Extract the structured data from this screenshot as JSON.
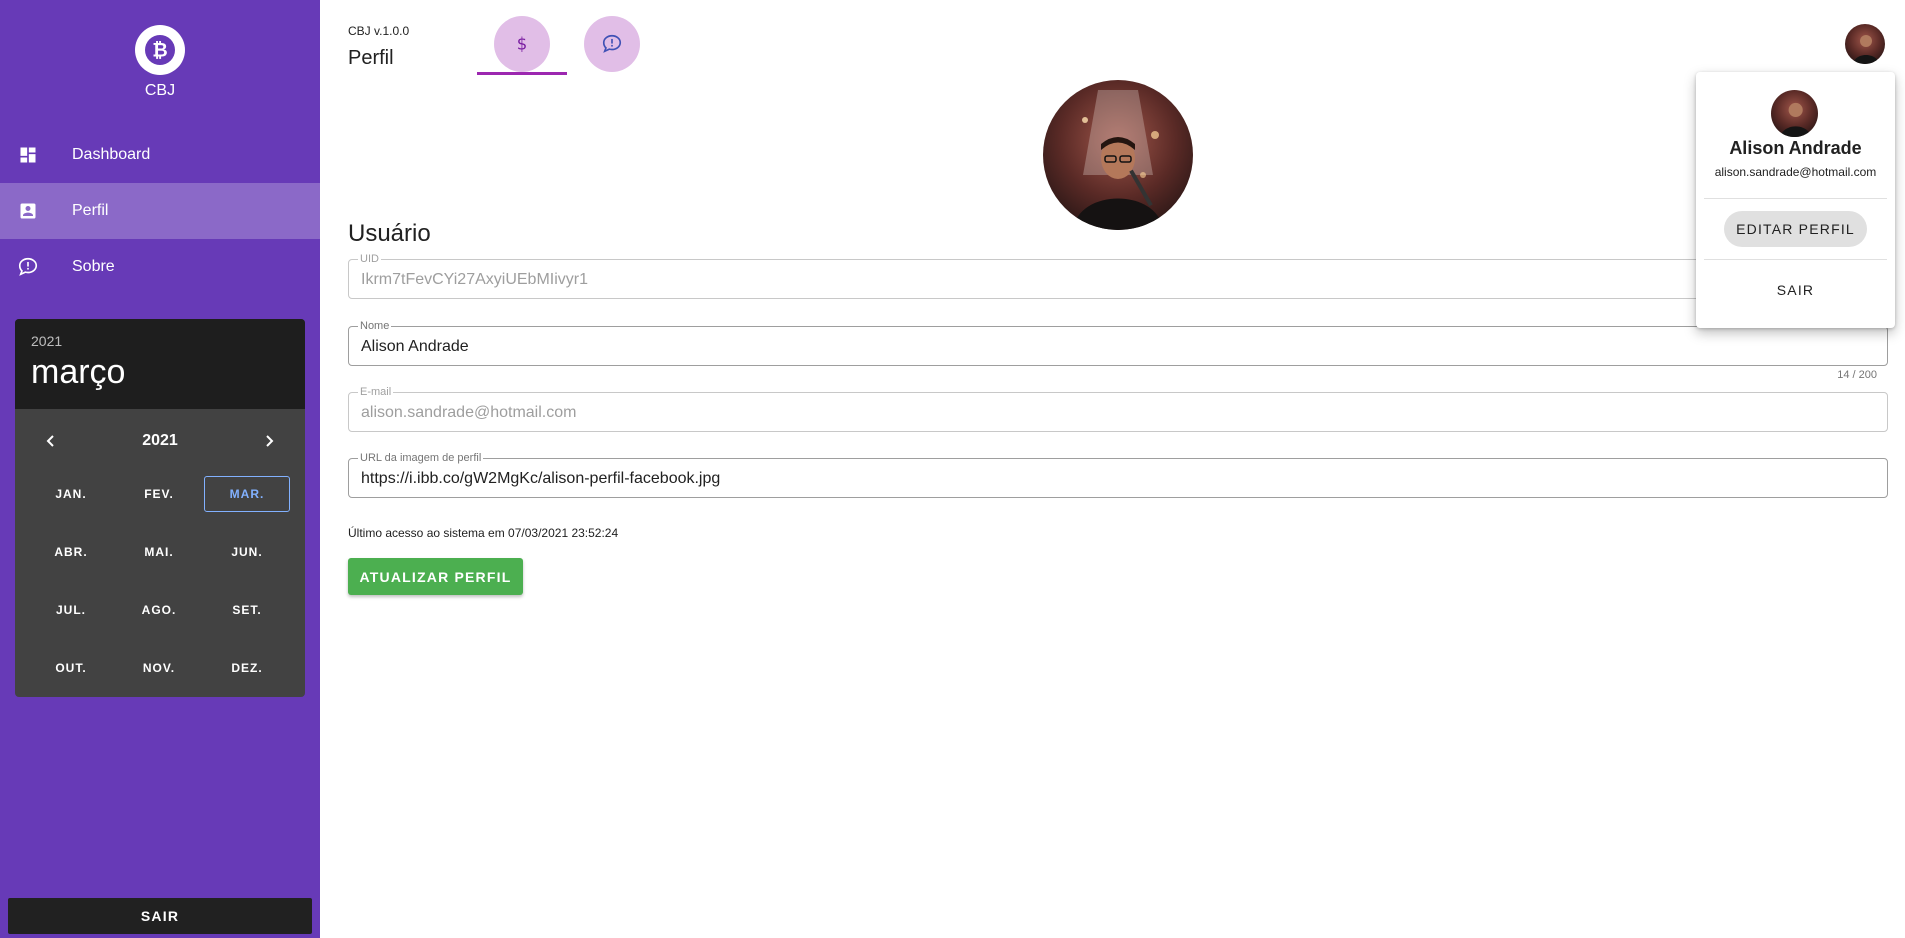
{
  "sidebar": {
    "brand_name": "CBJ",
    "brand_icon": "bitcoin-icon",
    "items": [
      {
        "label": "Dashboard",
        "icon": "dashboard-icon"
      },
      {
        "label": "Perfil",
        "icon": "account-box-icon",
        "active": true
      },
      {
        "label": "Sobre",
        "icon": "message-alert-icon"
      }
    ],
    "logout_label": "SAIR"
  },
  "date_picker": {
    "header_year": "2021",
    "header_month": "março",
    "nav_year": "2021",
    "months": [
      "JAN.",
      "FEV.",
      "MAR.",
      "ABR.",
      "MAI.",
      "JUN.",
      "JUL.",
      "AGO.",
      "SET.",
      "OUT.",
      "NOV.",
      "DEZ."
    ],
    "selected_month": "MAR."
  },
  "header": {
    "version": "CBJ v.1.0.0",
    "title": "Perfil",
    "buttons": [
      {
        "icon": "dollar-icon",
        "active": true
      },
      {
        "icon": "message-alert-icon"
      }
    ]
  },
  "profile": {
    "section_title": "Usuário",
    "fields": {
      "uid": {
        "label": "UID",
        "value": "Ikrm7tFevCYi27AxyiUEbMIivyr1",
        "disabled": true
      },
      "name": {
        "label": "Nome",
        "value": "Alison Andrade",
        "counter": "14 / 200"
      },
      "email": {
        "label": "E-mail",
        "value": "alison.sandrade@hotmail.com",
        "disabled": true
      },
      "image_url": {
        "label": "URL da imagem de perfil",
        "value": "https://i.ibb.co/gW2MgKc/alison-perfil-facebook.jpg"
      }
    },
    "last_access": "Último acesso ao sistema em 07/03/2021 23:52:24",
    "update_label": "ATUALIZAR PERFIL"
  },
  "user_menu": {
    "name": "Alison Andrade",
    "email": "alison.sandrade@hotmail.com",
    "edit_label": "EDITAR PERFIL",
    "exit_label": "SAIR"
  },
  "colors": {
    "sidebar": "#673ab7",
    "accent": "#9c27b0",
    "tab_button": "#e1bee7",
    "success": "#4caf50",
    "picker_selected": "#82b1ff"
  }
}
